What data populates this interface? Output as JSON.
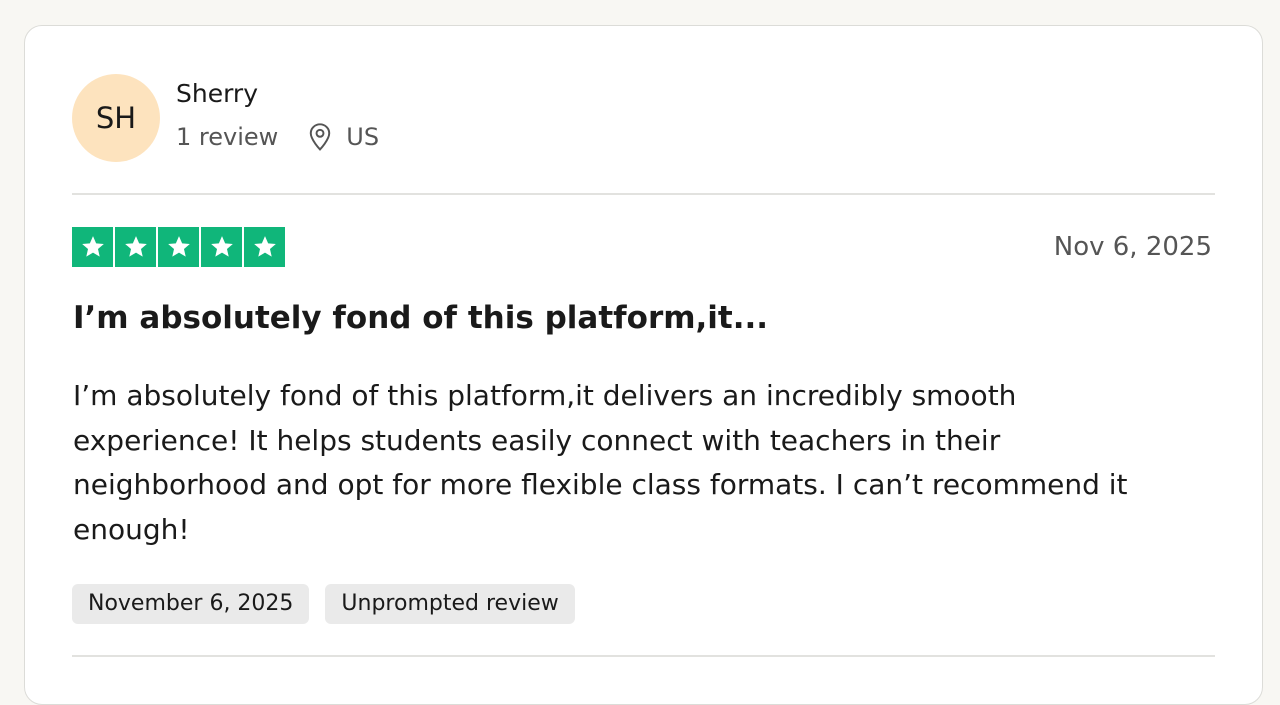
{
  "reviewer": {
    "initials": "SH",
    "name": "Sherry",
    "review_count": "1 review",
    "country": "US",
    "avatar_color": "#fde3be"
  },
  "review": {
    "rating": 5,
    "rating_max": 5,
    "star_color": "#10b67a",
    "date_short": "Nov 6, 2025",
    "title": "I’m absolutely fond of this platform,it...",
    "body": "I’m absolutely fond of this platform,it delivers an incredibly smooth experience! It helps students easily connect with teachers in their neighborhood and opt for more flexible class formats. I can’t recommend it enough!",
    "tags": {
      "date_of_experience": "November 6, 2025",
      "review_type": "Unprompted review"
    }
  },
  "icons": {
    "location": "location-pin-icon",
    "star": "star-icon"
  }
}
